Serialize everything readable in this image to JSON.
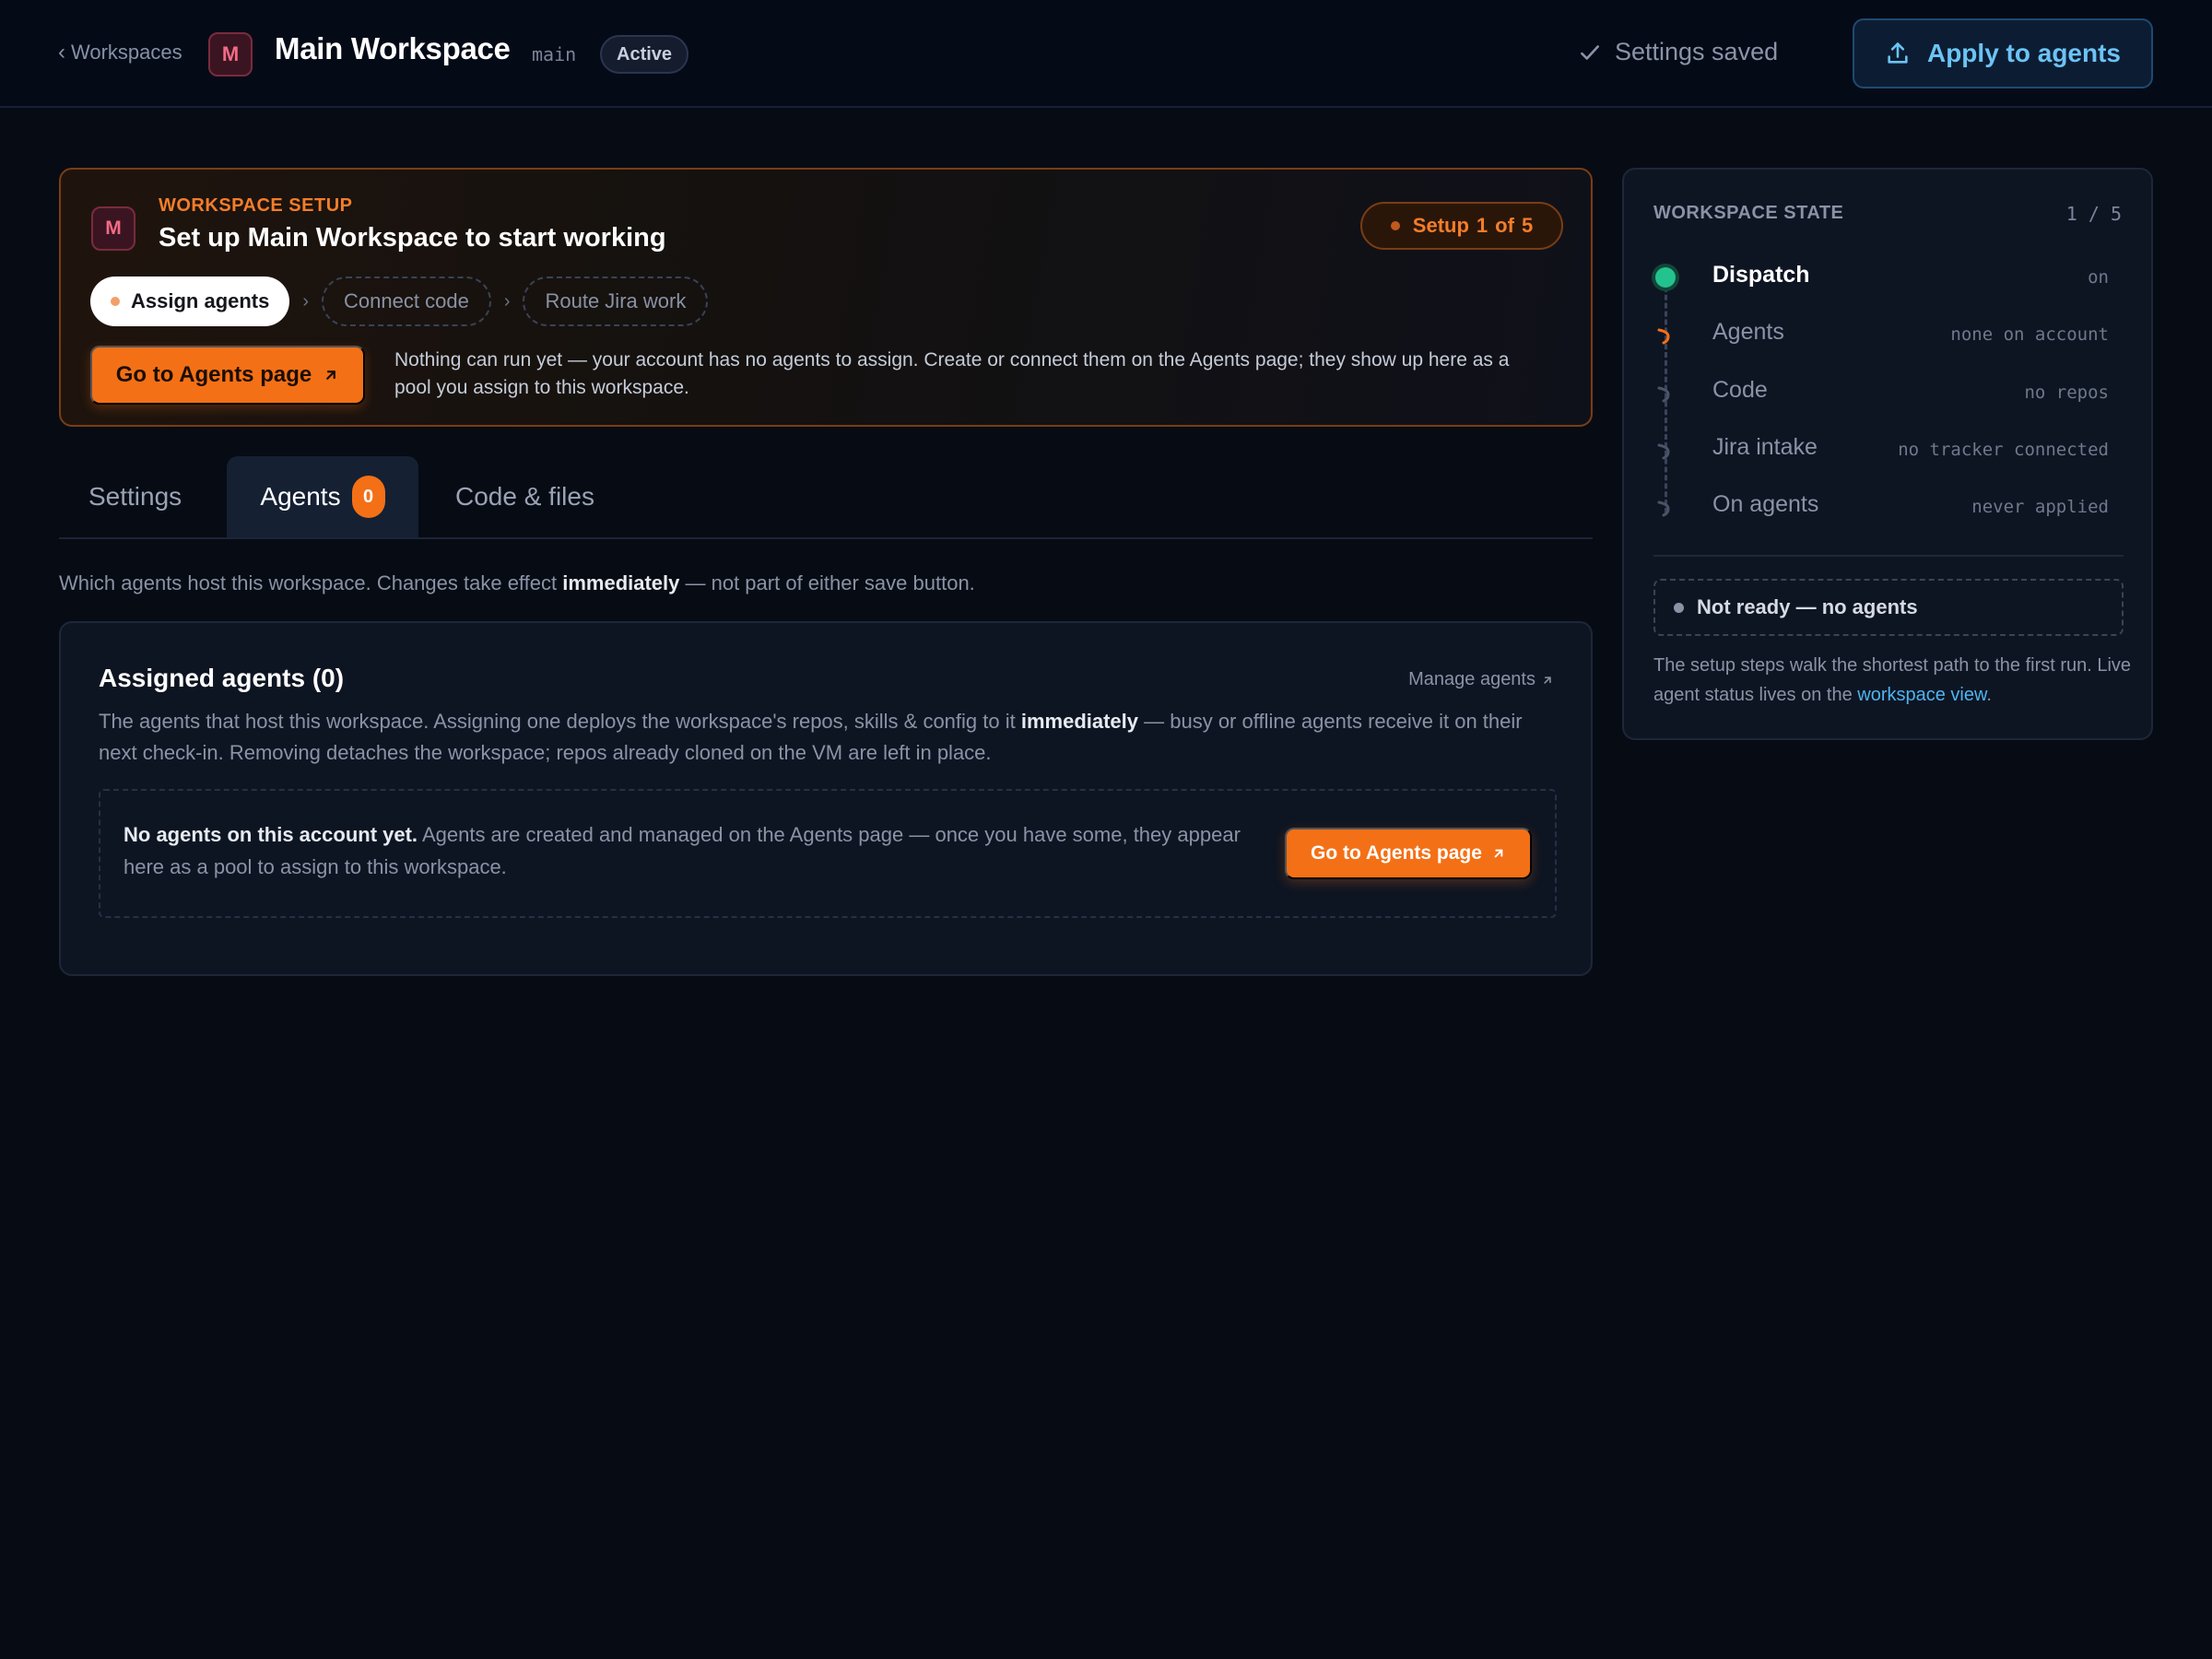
{
  "header": {
    "back_label": "Workspaces",
    "workspace_initial": "M",
    "workspace_name": "Main Workspace",
    "workspace_slug": "main",
    "status_badge": "Active",
    "saved_status": "Settings saved",
    "apply_button": "Apply to agents"
  },
  "setup": {
    "initial": "M",
    "eyebrow": "WORKSPACE SETUP",
    "title": "Set up Main Workspace to start working",
    "counter_prefix": "Setup",
    "counter_current": "1",
    "counter_of": "of",
    "counter_total": "5",
    "steps": [
      {
        "label": "Assign agents",
        "state": "current"
      },
      {
        "label": "Connect code",
        "state": "pending"
      },
      {
        "label": "Route Jira work",
        "state": "pending"
      }
    ],
    "cta_button": "Go to Agents page",
    "description": "Nothing can run yet — your account has no agents to assign. Create or connect them on the Agents page; they show up here as a pool you assign to this workspace."
  },
  "tabs": [
    {
      "label": "Settings",
      "active": false
    },
    {
      "label": "Agents",
      "active": true,
      "count": "0"
    },
    {
      "label": "Code & files",
      "active": false
    }
  ],
  "agents_tab": {
    "intro_before": "Which agents host this workspace. Changes take effect ",
    "intro_bold": "immediately",
    "intro_after": " — not part of either save button.",
    "panel_title": "Assigned agents (0)",
    "manage_link": "Manage agents",
    "panel_desc_before": "The agents that host this workspace. Assigning one deploys the workspace's repos, skills & config to it ",
    "panel_desc_bold": "immediately",
    "panel_desc_after": " — busy or offline agents receive it on their next check-in. Removing detaches the workspace; repos already cloned on the VM are left in place.",
    "empty_bold": "No agents on this account yet.",
    "empty_text": " Agents are created and managed on the Agents page — once you have some, they appear here as a pool to assign to this workspace.",
    "empty_button": "Go to Agents page"
  },
  "state": {
    "title": "WORKSPACE STATE",
    "progress": "1 / 5",
    "rows": [
      {
        "label": "Dispatch",
        "value": "on",
        "status": "done"
      },
      {
        "label": "Agents",
        "value": "none on account",
        "status": "current"
      },
      {
        "label": "Code",
        "value": "no repos",
        "status": "pending"
      },
      {
        "label": "Jira intake",
        "value": "no tracker connected",
        "status": "pending"
      },
      {
        "label": "On agents",
        "value": "never applied",
        "status": "pending"
      }
    ],
    "not_ready": "Not ready — no agents",
    "note_before": "The setup steps walk the shortest path to the first run. Live agent status lives on the ",
    "note_link": "workspace view",
    "note_after": "."
  },
  "colors": {
    "accent_orange": "#f47016",
    "accent_blue": "#6cc3f5",
    "done_green": "#22c38e",
    "background": "#070b14"
  }
}
